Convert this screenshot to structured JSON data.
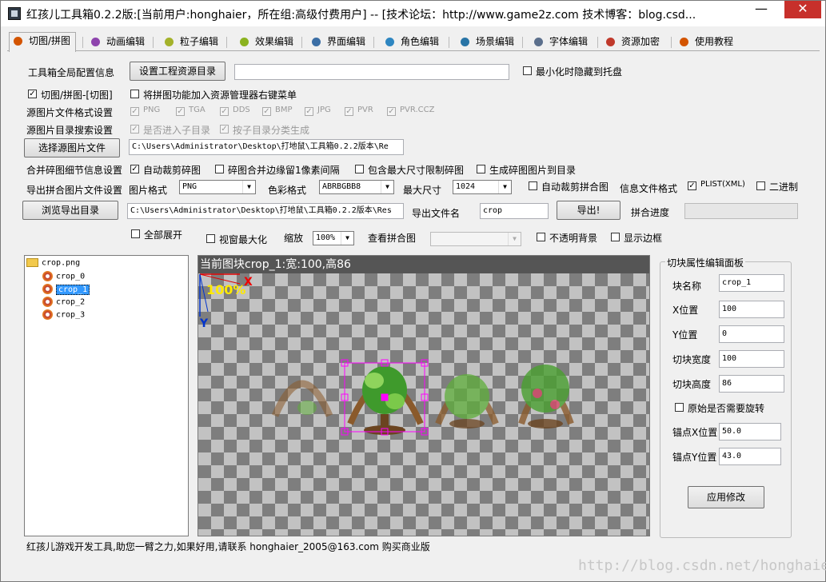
{
  "window": {
    "title": "红孩儿工具箱0.2.2版:[当前用户:honghaier，所在组:高级付费用户]  --  [技术论坛：http://www.game2z.com 技术博客：blog.csd..."
  },
  "tabs": [
    {
      "label": "切图/拼图",
      "color": "#d35400"
    },
    {
      "label": "动画编辑",
      "color": "#8e44ad"
    },
    {
      "label": "粒子编辑",
      "color": "#a4b22a"
    },
    {
      "label": "效果编辑",
      "color": "#8bb21f"
    },
    {
      "label": "界面编辑",
      "color": "#3b6ea5"
    },
    {
      "label": "角色编辑",
      "color": "#2e86c1"
    },
    {
      "label": "场景编辑",
      "color": "#2874a6"
    },
    {
      "label": "字体编辑",
      "color": "#5b6f8c"
    },
    {
      "label": "资源加密",
      "color": "#c0392b"
    },
    {
      "label": "使用教程",
      "color": "#d35400"
    }
  ],
  "config": {
    "global_label": "工具箱全局配置信息",
    "set_resource_dir_btn": "设置工程资源目录",
    "resource_dir_value": "",
    "minimize_to_tray": "最小化时隐藏到托盘",
    "cut_mode_label": "切图/拼图-[切图]",
    "add_context_menu": "将拼图功能加入资源管理器右键菜单",
    "source_format_label": "源图片文件格式设置",
    "formats": [
      "PNG",
      "TGA",
      "DDS",
      "BMP",
      "JPG",
      "PVR",
      "PVR.CCZ"
    ],
    "source_dir_search_label": "源图片目录搜索设置",
    "include_subdirs": "是否进入子目录",
    "group_by_subdir": "按子目录分类生成",
    "select_source_btn": "选择源图片文件",
    "source_path": "C:\\Users\\Administrator\\Desktop\\打地鼠\\工具箱0.2.2版本\\Re",
    "merge_detail_label": "合并碎图细节信息设置",
    "auto_trim": "自动裁剪碎图",
    "keep_1px_gap": "碎图合并边缘留1像素间隔",
    "max_size_limit": "包含最大尺寸限制碎图",
    "gen_to_dir": "生成碎图图片到目录",
    "export_settings_label": "导出拼合图片文件设置",
    "image_format_label": "图片格式",
    "image_format_value": "PNG",
    "color_format_label": "色彩格式",
    "color_format_value": "ABRBGBB8",
    "max_size_label": "最大尺寸",
    "max_size_value": "1024",
    "auto_trim_merged": "自动裁剪拼合图",
    "info_format_label": "信息文件格式",
    "plist_label": "PLIST(XML)",
    "binary_label": "二进制",
    "browse_export_btn": "浏览导出目录",
    "export_path": "C:\\Users\\Administrator\\Desktop\\打地鼠\\工具箱0.2.2版本\\Res",
    "export_name_label": "导出文件名",
    "export_name_value": "crop",
    "export_btn": "导出!",
    "merge_progress_label": "拼合进度",
    "expand_all": "全部展开",
    "window_maximize": "视窗最大化",
    "zoom_label": "缩放",
    "zoom_value": "100%",
    "view_merged_label": "查看拼合图",
    "opaque_bg": "不透明背景",
    "show_border": "显示边框"
  },
  "tree": {
    "root": "crop.png",
    "children": [
      "crop_0",
      "crop_1",
      "crop_2",
      "crop_3"
    ],
    "selected_index": 1
  },
  "canvas": {
    "header": "当前图块crop_1:宽:100,高86",
    "zoom_text": "100%",
    "axis_x": "X",
    "axis_y": "Y"
  },
  "panel": {
    "title": "切块属性编辑面板",
    "name_label": "块名称",
    "name_value": "crop_1",
    "x_label": "X位置",
    "x_value": "100",
    "y_label": "Y位置",
    "y_value": "0",
    "width_label": "切块宽度",
    "width_value": "100",
    "height_label": "切块高度",
    "height_value": "86",
    "rotate_label": "原始是否需要旋转",
    "anchor_x_label": "锚点X位置",
    "anchor_x_value": "50.0",
    "anchor_y_label": "锚点Y位置",
    "anchor_y_value": "43.0",
    "apply_btn": "应用修改"
  },
  "status": "红孩儿游戏开发工具,助您一臂之力,如果好用,请联系 honghaier_2005@163.com 购买商业版",
  "watermark": "http://blog.csdn.net/honghaier"
}
